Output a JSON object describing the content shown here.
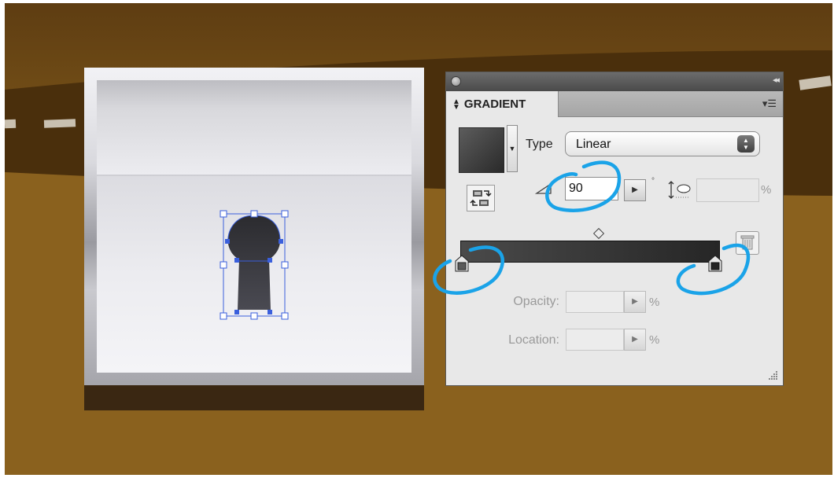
{
  "panel": {
    "title": "GRADIENT",
    "type_label": "Type",
    "type_value": "Linear",
    "angle_value": "90",
    "degree_symbol": "°",
    "percent_symbol": "%",
    "opacity_label": "Opacity:",
    "location_label": "Location:",
    "collapse_glyph": "◂◂",
    "menu_glyph": "▾☰"
  },
  "colors": {
    "background_brown": "#7a5418",
    "annotation_blue": "#1aa3e8",
    "selection_blue": "#3a5fdc"
  },
  "icons": [
    "close-icon",
    "panel-collapse-icon",
    "panel-menu-icon",
    "reverse-gradient-icon",
    "angle-icon",
    "aspect-ratio-icon",
    "delete-stop-icon",
    "resize-grip-icon"
  ]
}
